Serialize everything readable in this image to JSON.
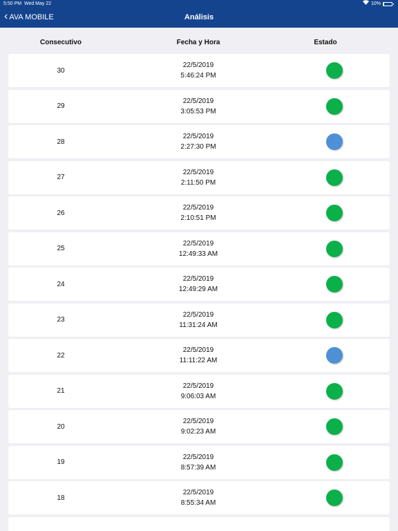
{
  "status_bar": {
    "time": "5:50 PM",
    "date": "Wed May 22",
    "battery_text": "10%",
    "battery_level": 0.1,
    "wifi_icon": "wifi-icon"
  },
  "nav": {
    "back_label": "AVA MOBILE",
    "title": "Análisis",
    "bar_color": "#14448e"
  },
  "columns": {
    "consecutivo": "Consecutivo",
    "fecha": "Fecha y Hora",
    "estado": "Estado"
  },
  "status_colors": {
    "green": "#0bb04a",
    "blue": "#4f8fd6"
  },
  "rows": [
    {
      "num": "30",
      "date": "22/5/2019",
      "time": "5:46:24 PM",
      "status": "green"
    },
    {
      "num": "29",
      "date": "22/5/2019",
      "time": "3:05:53 PM",
      "status": "green"
    },
    {
      "num": "28",
      "date": "22/5/2019",
      "time": "2:27:30 PM",
      "status": "blue"
    },
    {
      "num": "27",
      "date": "22/5/2019",
      "time": "2:11:50 PM",
      "status": "green"
    },
    {
      "num": "26",
      "date": "22/5/2019",
      "time": "2:10:51 PM",
      "status": "green"
    },
    {
      "num": "25",
      "date": "22/5/2019",
      "time": "12:49:33 AM",
      "status": "green"
    },
    {
      "num": "24",
      "date": "22/5/2019",
      "time": "12:49:29 AM",
      "status": "green"
    },
    {
      "num": "23",
      "date": "22/5/2019",
      "time": "11:31:24 AM",
      "status": "green"
    },
    {
      "num": "22",
      "date": "22/5/2019",
      "time": "11:11:22 AM",
      "status": "blue"
    },
    {
      "num": "21",
      "date": "22/5/2019",
      "time": "9:06:03 AM",
      "status": "green"
    },
    {
      "num": "20",
      "date": "22/5/2019",
      "time": "9:02:23 AM",
      "status": "green"
    },
    {
      "num": "19",
      "date": "22/5/2019",
      "time": "8:57:39 AM",
      "status": "green"
    },
    {
      "num": "18",
      "date": "22/5/2019",
      "time": "8:55:34 AM",
      "status": "green"
    },
    {
      "num": "",
      "date": "",
      "time": "",
      "status": ""
    }
  ]
}
